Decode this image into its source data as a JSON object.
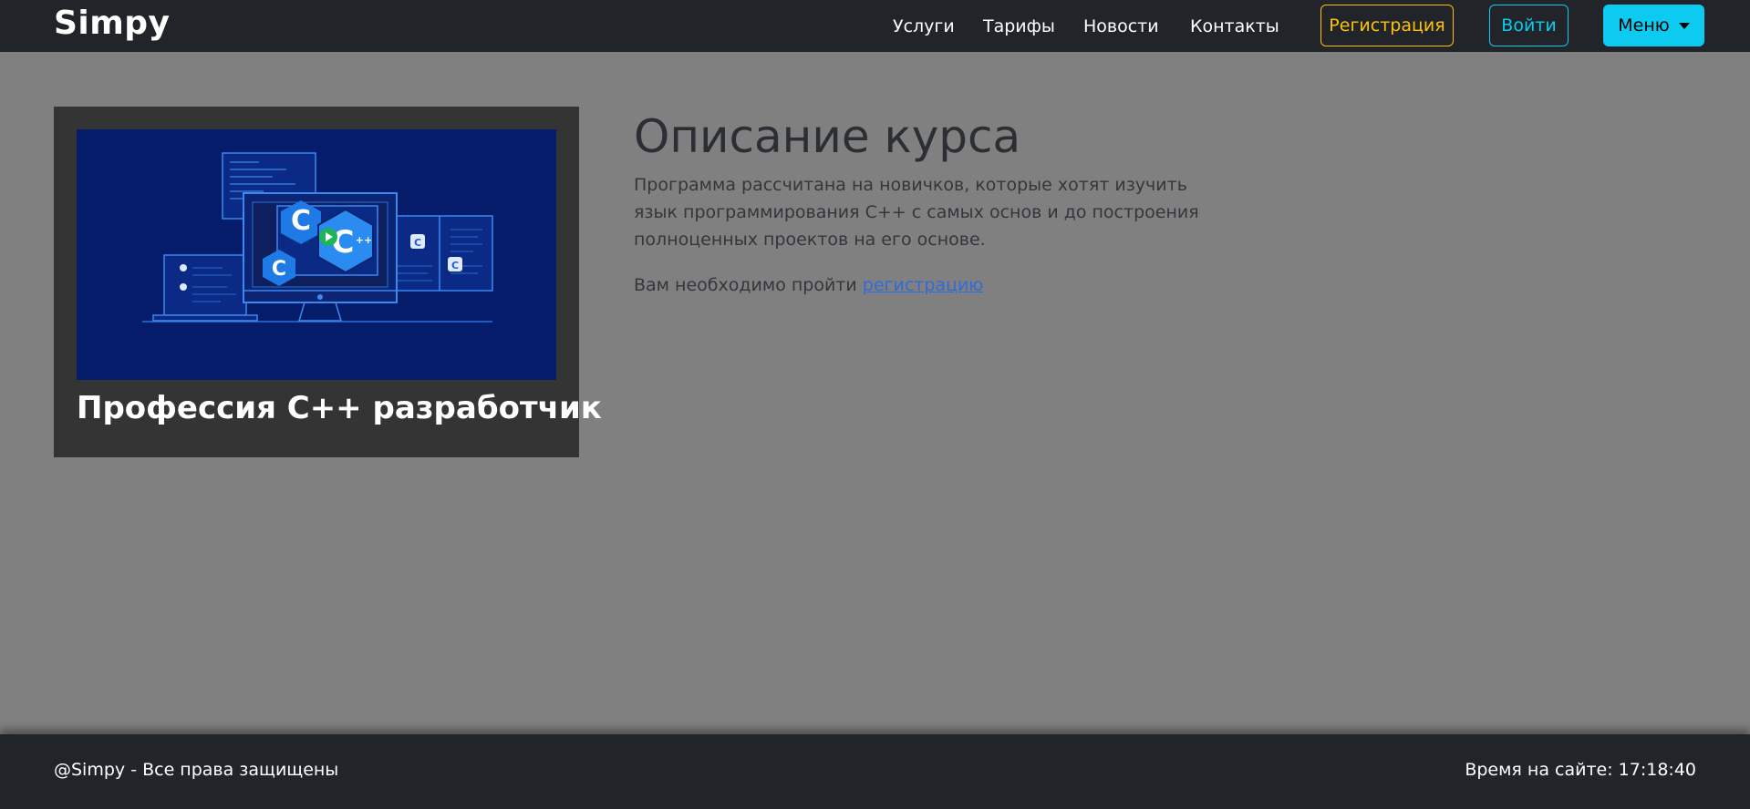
{
  "navbar": {
    "brand": "Simpy",
    "links": [
      "Услуги",
      "Тарифы",
      "Новости",
      "Контакты"
    ],
    "register_label": "Регистрация",
    "login_label": "Войти",
    "menu_label": "Меню"
  },
  "course_card": {
    "title": "Профессия C++ разработчик",
    "image_icon": "cpp-devices-illustration"
  },
  "description": {
    "heading": "Описание курса",
    "text": "Программа рассчитана на новичков, которые хотят изучить язык программирования C++ с самых основ и до построения полноценных проектов на его основе.",
    "register_prefix": "Вам необходимо пройти",
    "register_link": "регистрацию"
  },
  "footer": {
    "copyright": "@Simpy - Все права защищены",
    "time_label": "Время на сайте:",
    "time_value": "17:18:40"
  },
  "colors": {
    "navbar_bg": "#212529",
    "page_bg": "#808080",
    "warning": "#ffc107",
    "info": "#0dcaf0",
    "link": "#2f6ae0"
  }
}
